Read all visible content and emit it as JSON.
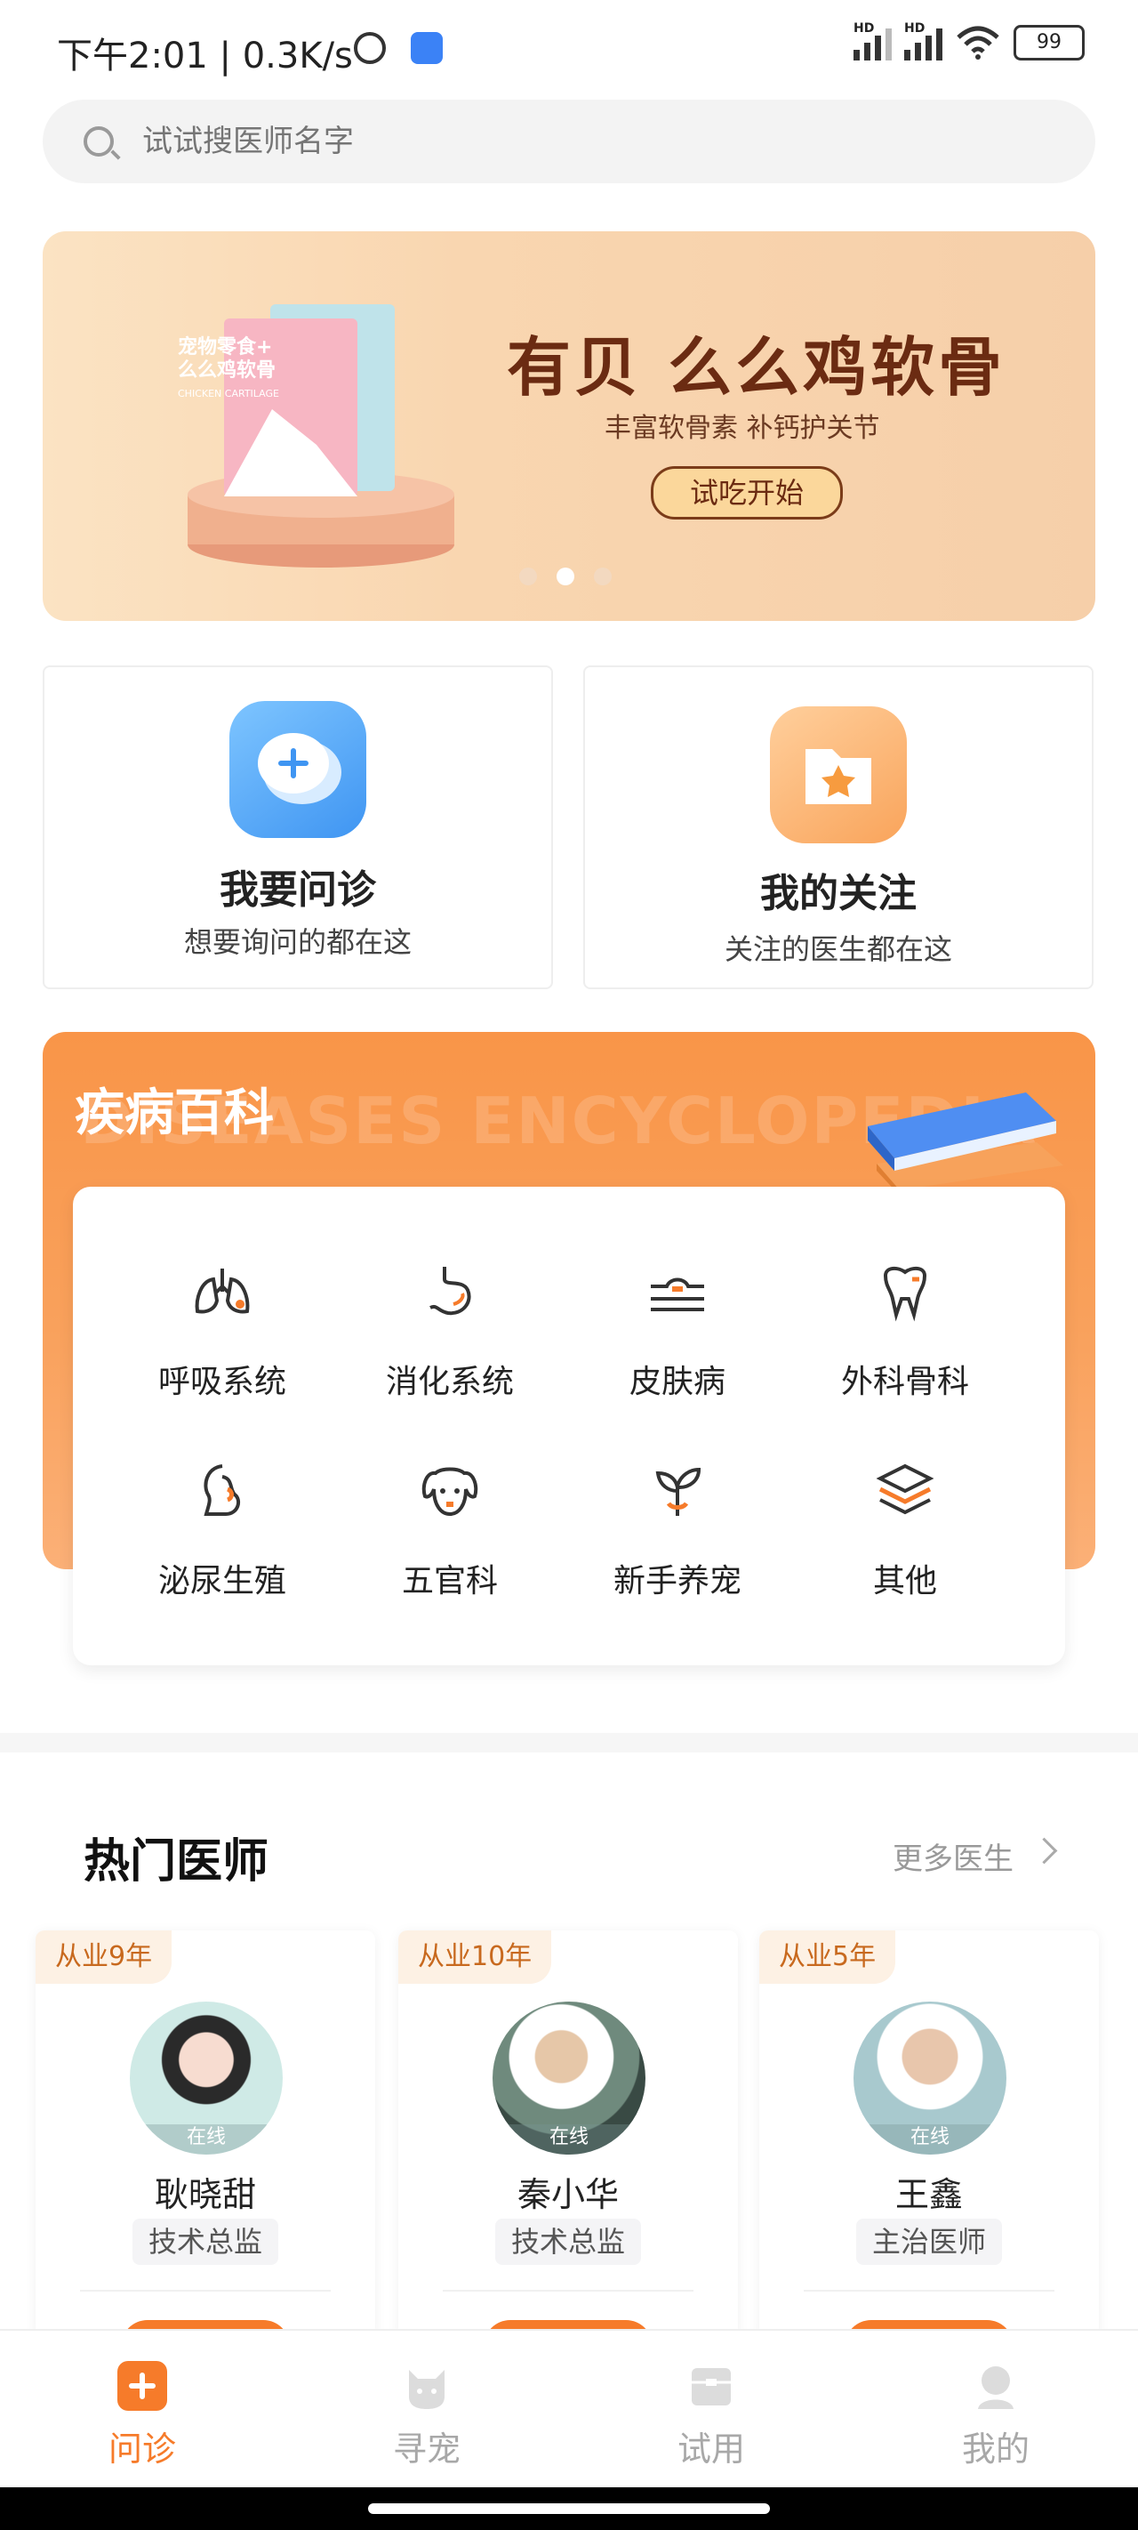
{
  "status_bar": {
    "time_speed": "下午2:01 | 0.3K/s",
    "signal_label": "HD",
    "battery": "99",
    "icons": [
      "alarm-icon",
      "app-notification-icon",
      "signal-icon",
      "signal-icon",
      "wifi-icon",
      "battery-icon"
    ]
  },
  "search": {
    "placeholder": "试试搜医师名字"
  },
  "banner": {
    "title": "有贝 么么鸡软骨",
    "subtitle": "丰富软骨素 补钙护关节",
    "button": "试吃开始",
    "package_text": "宠物零食+ 么么鸡软骨",
    "package_subtext": "CHICKEN CARTILAGE",
    "active_dot": 1,
    "dot_count": 3
  },
  "features": [
    {
      "title": "我要问诊",
      "subtitle": "想要询问的都在这",
      "icon": "chat-plus-icon"
    },
    {
      "title": "我的关注",
      "subtitle": "关注的医生都在这",
      "icon": "star-folder-icon"
    }
  ],
  "encyclopedia": {
    "title": "疾病百科",
    "watermark": "DISEASES ENCYCLOPEDIA",
    "categories": [
      {
        "label": "呼吸系统",
        "icon": "lungs-icon"
      },
      {
        "label": "消化系统",
        "icon": "stomach-icon"
      },
      {
        "label": "皮肤病",
        "icon": "skin-icon"
      },
      {
        "label": "外科骨科",
        "icon": "tooth-bone-icon"
      },
      {
        "label": "泌尿生殖",
        "icon": "urinary-icon"
      },
      {
        "label": "五官科",
        "icon": "dog-face-icon"
      },
      {
        "label": "新手养宠",
        "icon": "sprout-icon"
      },
      {
        "label": "其他",
        "icon": "layers-icon"
      }
    ]
  },
  "doctors": {
    "title": "热门医师",
    "more": "更多医生",
    "online_label": "在线",
    "list": [
      {
        "experience": "从业9年",
        "name": "耿晓甜",
        "role": "技术总监"
      },
      {
        "experience": "从业10年",
        "name": "秦小华",
        "role": "技术总监"
      },
      {
        "experience": "从业5年",
        "name": "王鑫",
        "role": "主治医师"
      }
    ]
  },
  "tabbar": {
    "active_color": "#f67b2a",
    "items": [
      {
        "label": "问诊",
        "icon": "consult-icon",
        "active": true
      },
      {
        "label": "寻宠",
        "icon": "cat-icon",
        "active": false
      },
      {
        "label": "试用",
        "icon": "trial-box-icon",
        "active": false
      },
      {
        "label": "我的",
        "icon": "profile-icon",
        "active": false
      }
    ]
  },
  "colors": {
    "accent": "#f67b2a",
    "banner_text": "#6b2b12",
    "encyclopedia_bg": "#f99548"
  }
}
